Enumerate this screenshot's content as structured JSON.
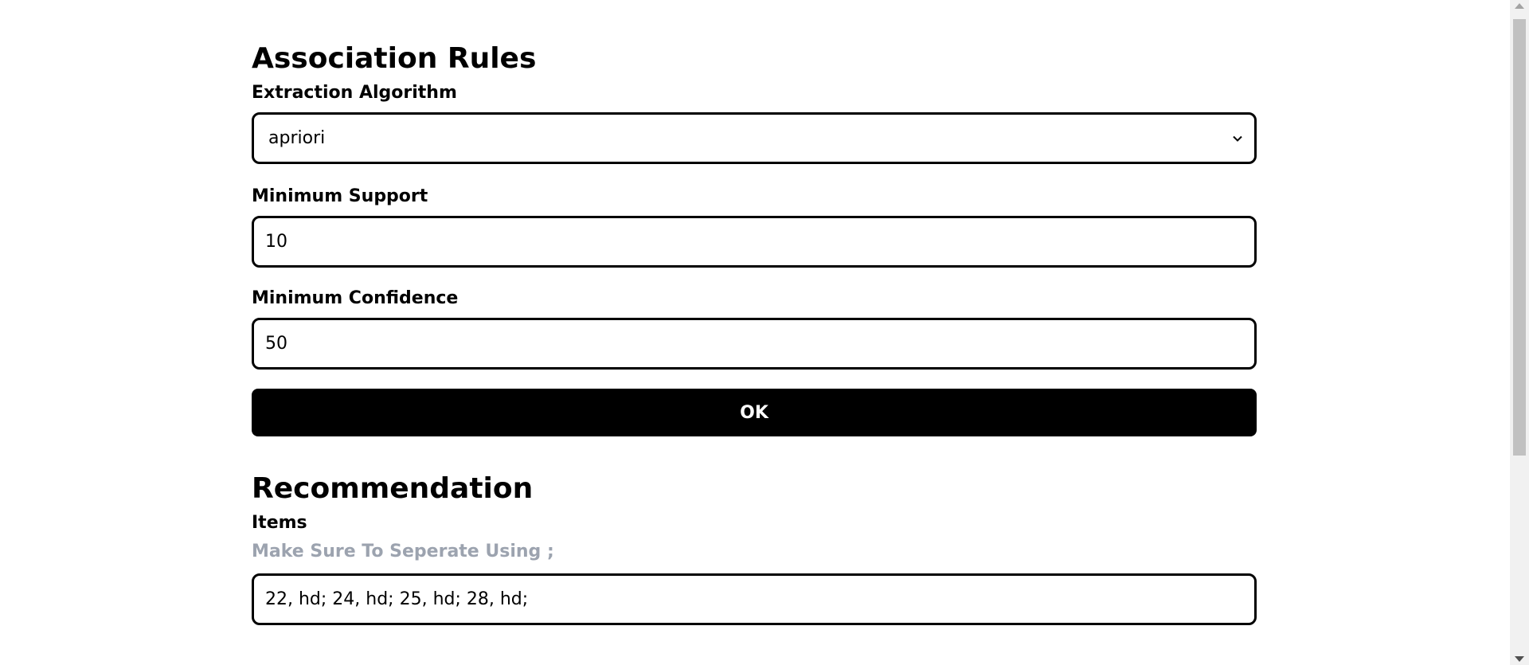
{
  "association": {
    "title": "Association Rules",
    "algorithm_label": "Extraction Algorithm",
    "algorithm_value": "apriori",
    "support_label": "Minimum Support",
    "support_value": "10",
    "confidence_label": "Minimum Confidence",
    "confidence_value": "50",
    "ok_label": "OK"
  },
  "recommendation": {
    "title": "Recommendation",
    "items_label": "Items",
    "items_hint": "Make Sure To Seperate Using ;",
    "items_value": "22, hd; 24, hd; 25, hd; 28, hd;"
  },
  "icons": {
    "select_chevron": "chevron-down-icon",
    "scroll_up": "scroll-up-arrow-icon",
    "scroll_down": "scroll-down-arrow-icon"
  },
  "colors": {
    "text": "#000000",
    "hint": "#9ca3af",
    "button_bg": "#000000",
    "button_text": "#ffffff",
    "field_border": "#000000"
  }
}
